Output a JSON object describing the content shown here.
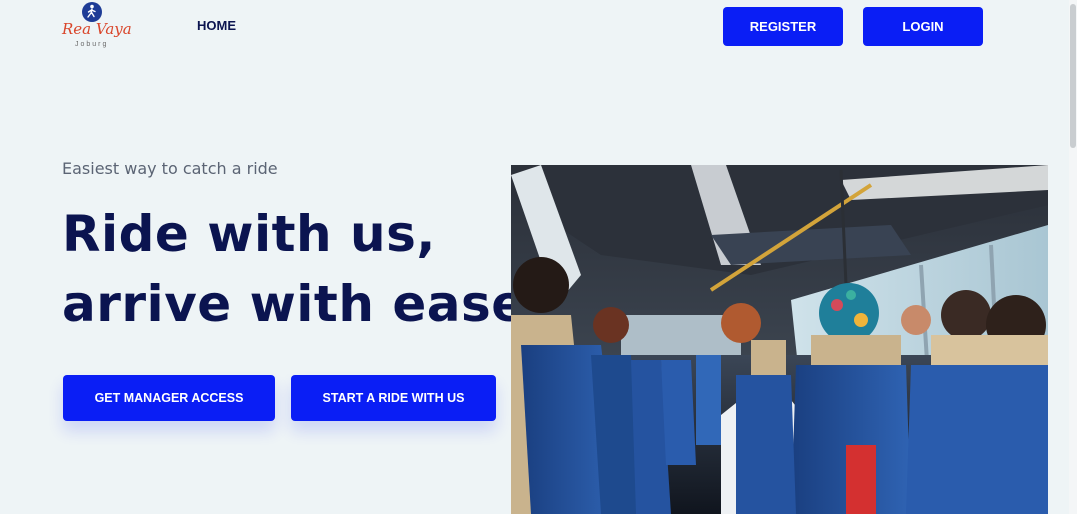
{
  "brand": {
    "logo_text": "Rea Vaya",
    "logo_subtext": "Joburg",
    "logo_icon": "walking-person-icon",
    "logo_color": "#d9462b",
    "logo_icon_color": "#1e3c96"
  },
  "nav": {
    "home_label": "HOME",
    "register_label": "REGISTER",
    "login_label": "LOGIN"
  },
  "hero": {
    "tagline": "Easiest way to catch a ride",
    "headline_line1": "Ride with us,",
    "headline_line2": "arrive with ease",
    "primary_button_label": "GET MANAGER ACCESS",
    "secondary_button_label": "START A RIDE WITH US",
    "image_subject": "bus-interior-photo"
  },
  "colors": {
    "accent": "#0a1ef5",
    "heading": "#0b1450",
    "background": "#eef4f6",
    "muted_text": "#5b6474"
  }
}
